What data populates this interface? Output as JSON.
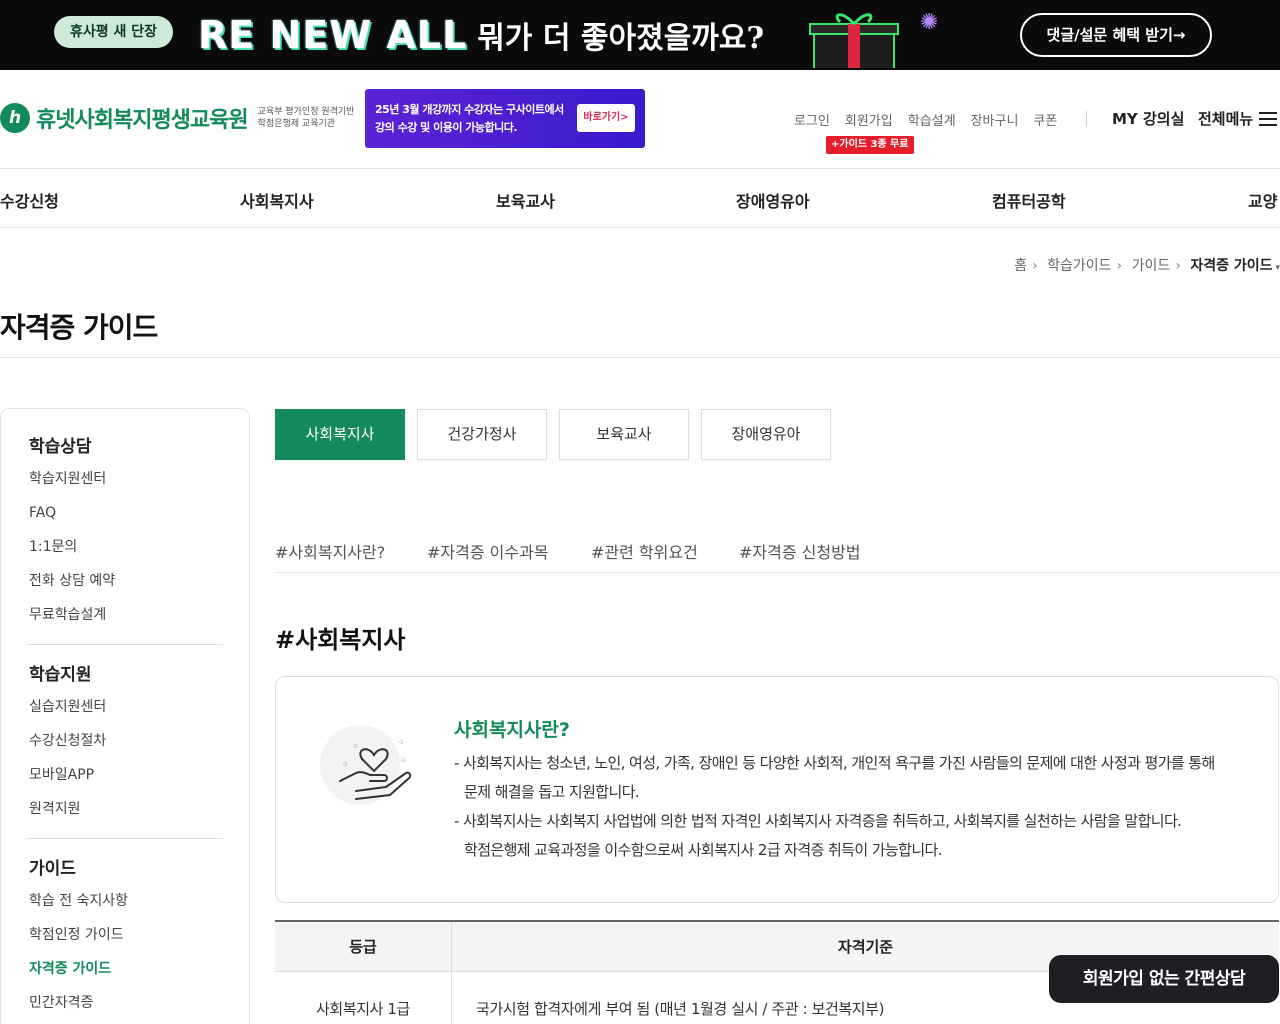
{
  "banner": {
    "pill_prefix": "휴사평",
    "pill_new": "새 단장",
    "headline_renew": "RE NEW ALL",
    "headline_question": "뭐가 더 좋아졌을까요?",
    "cta": "댓글/설문 혜택 받기→"
  },
  "header": {
    "logo_mark": "ᄒ",
    "logo_text": "휴넷사회복지평생교육원",
    "logo_sub_1": "교육부 평가인정 원격기반",
    "logo_sub_2": "학점은행제 교육기관",
    "promo_line1": "25년 3월 개강까지 수강자는 구사이트에서",
    "promo_line2": "강의 수강 및 이용이 가능합니다.",
    "promo_button": "바로가기>",
    "util": [
      "로그인",
      "회원가입",
      "학습설계",
      "장바구니",
      "쿠폰"
    ],
    "util_badge": "+가이드 3종 무료",
    "my_class": "MY 강의실",
    "all_menu": "전체메뉴"
  },
  "gnb": [
    "수강신청",
    "사회복지사",
    "보육교사",
    "장애영유아",
    "컴퓨터공학",
    "교양"
  ],
  "breadcrumb": [
    "홈",
    "학습가이드",
    "가이드",
    "자격증 가이드"
  ],
  "page_title": "자격증 가이드",
  "lnb": {
    "groups": [
      {
        "title": "학습상담",
        "items": [
          "학습지원센터",
          "FAQ",
          "1:1문의",
          "전화 상담 예약",
          "무료학습설계"
        ]
      },
      {
        "title": "학습지원",
        "items": [
          "실습지원센터",
          "수강신청절차",
          "모바일APP",
          "원격지원"
        ]
      },
      {
        "title": "가이드",
        "items": [
          "학습 전 숙지사항",
          "학점인정 가이드",
          "자격증 가이드",
          "민간자격증"
        ]
      }
    ],
    "active": "자격증 가이드"
  },
  "tabs": [
    "사회복지사",
    "건강가정사",
    "보육교사",
    "장애영유아"
  ],
  "active_tab": "사회복지사",
  "anchors": [
    "#사회복지사란?",
    "#자격증 이수과목",
    "#관련 학위요건",
    "#자격증 신청방법"
  ],
  "section_heading": "#사회복지사",
  "card": {
    "title": "사회복지사란?",
    "lines": [
      "- 사회복지사는 청소년, 노인, 여성, 가족, 장애인 등 다양한 사회적, 개인적 욕구를 가진 사람들의 문제에 대한 사정과 평가를 통해",
      "  문제 해결을 돕고 지원합니다.",
      "- 사회복지사는 사회복지 사업법에 의한 법적 자격인 사회복지사 자격증을 취득하고, 사회복지를 실천하는 사람을 말합니다.",
      "  학점은행제 교육과정을 이수함으로써 사회복지사 2급 자격증 취득이 가능합니다."
    ]
  },
  "table": {
    "headers": [
      "등급",
      "자격기준"
    ],
    "rows": [
      [
        "사회복지사 1급",
        "국가시험 합격자에게 부여 됨 (매년 1월경 실시 / 주관 : 보건복지부)"
      ]
    ]
  },
  "floating_button": "회원가입 없는 간편상담",
  "colors": {
    "brand_green": "#138a5b",
    "banner_bg": "#0a0a0a",
    "promo_purple": "#4a1fd2",
    "badge_red": "#e61e2b"
  }
}
